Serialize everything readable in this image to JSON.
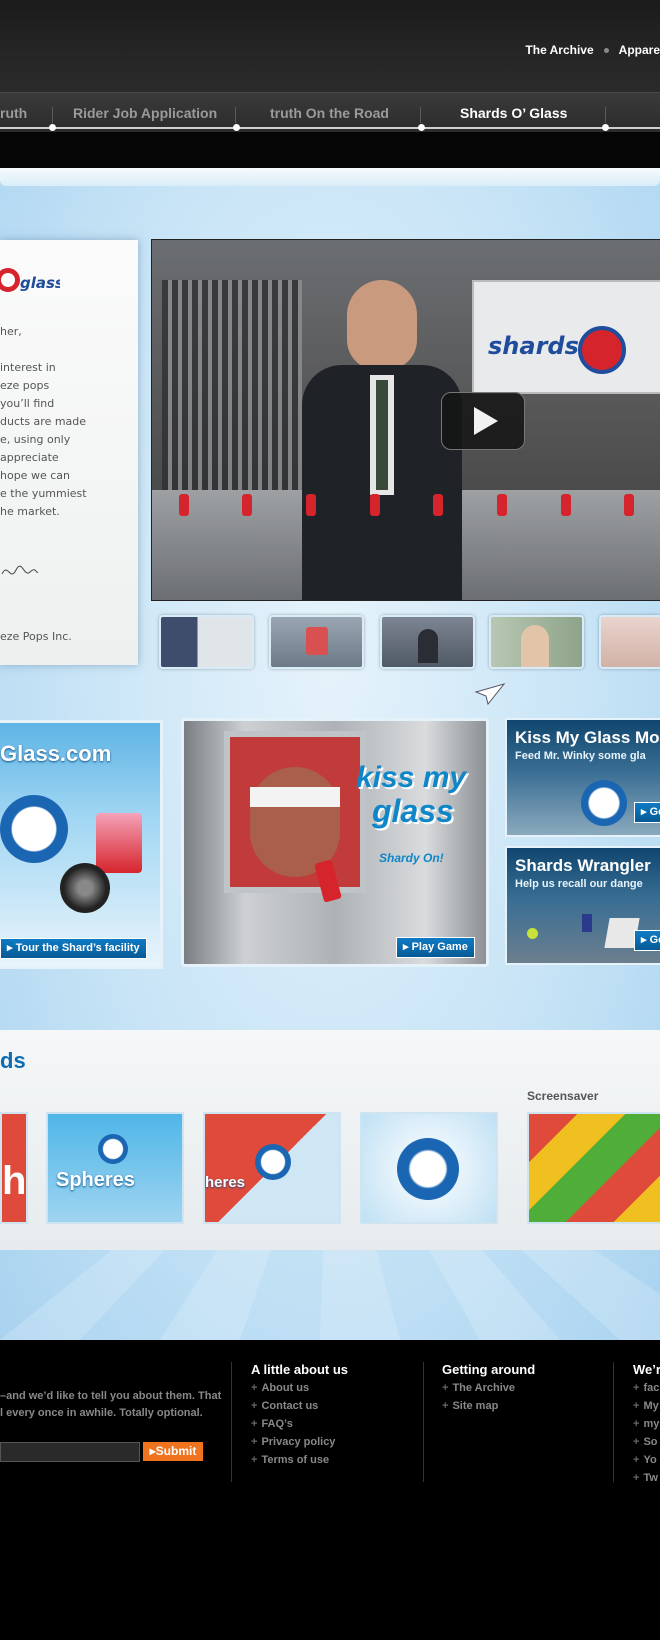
{
  "top_links": [
    "The Archive",
    "Appare"
  ],
  "nav": {
    "items": [
      {
        "label": "ruth",
        "active": false
      },
      {
        "label": "Rider Job Application",
        "active": false
      },
      {
        "label": "truth On the Road",
        "active": false
      },
      {
        "label": "Shards O’ Glass",
        "active": true
      }
    ]
  },
  "letter": {
    "lines": [
      "her,",
      "",
      "interest in",
      "eze pops",
      "you’ll find",
      "ducts are made",
      "e, using only",
      "appreciate",
      "hope we can",
      "e the yummiest",
      "he market."
    ],
    "footer": "eze Pops Inc.",
    "logo_text": "glass"
  },
  "video": {
    "sign_text": "shards",
    "play_label": "play-video"
  },
  "promos": {
    "left_title": "Glass.com",
    "left_button": "Tour the Shard’s facility",
    "center_title_1": "kiss my",
    "center_title_2": "glass",
    "center_tagline": "Shardy On!",
    "center_button": "Play Game",
    "kiss_title": "Kiss My Glass Mo",
    "kiss_sub": "Feed Mr. Winky some gla",
    "kiss_button": "Ge",
    "wrangler_title": "Shards Wrangler",
    "wrangler_sub": "Help us recall our dange",
    "wrangler_button": "Ge"
  },
  "downloads": {
    "title": "ds",
    "screensaver_label": "Screensaver",
    "tile1_text": "h",
    "tile2_text": "Spheres",
    "tile3_text": "heres"
  },
  "footer": {
    "intro_lines": [
      "–and we’d like to tell you about them. That",
      "l every once in awhile. Totally optional."
    ],
    "submit": "Submit",
    "col1": {
      "title": "A little about us",
      "links": [
        "About us",
        "Contact us",
        "FAQ’s",
        "Privacy policy",
        "Terms of use"
      ]
    },
    "col2": {
      "title": "Getting around",
      "links": [
        "The Archive",
        "Site map"
      ]
    },
    "col3": {
      "title": "We’r",
      "links": [
        "fac",
        "My",
        "my",
        "So",
        "Yo",
        "Tw"
      ]
    }
  },
  "colors": {
    "accent": "#0c6db3",
    "submit": "#f0731f",
    "header_bg": "#1b1b1b"
  }
}
